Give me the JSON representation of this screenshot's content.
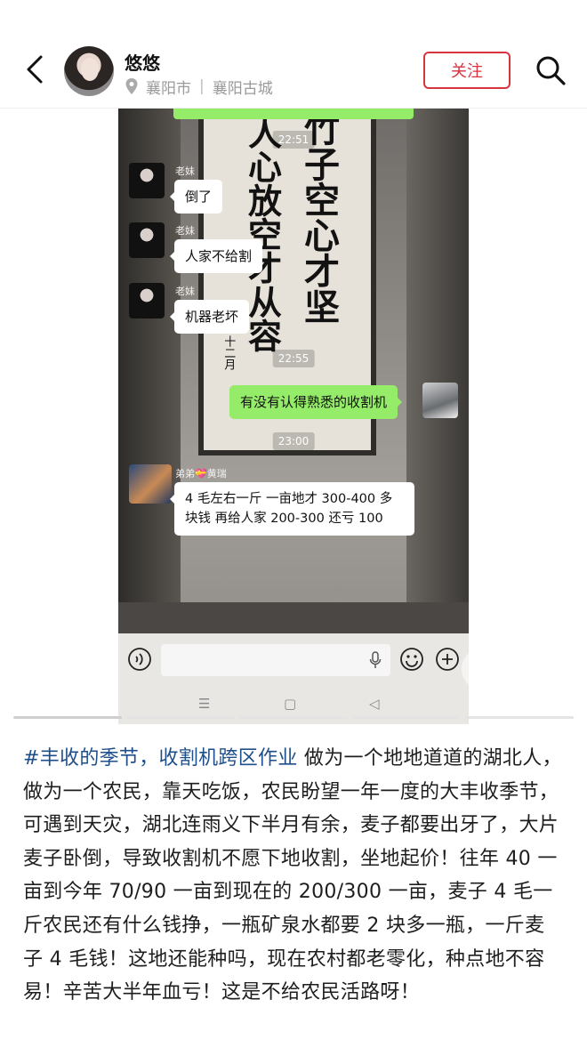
{
  "header": {
    "author": "悠悠",
    "location_city": "襄阳市",
    "location_separator": "|",
    "location_place": "襄阳古城",
    "follow_label": "关注"
  },
  "chat": {
    "messages": [
      {
        "type": "time",
        "text": "22:51"
      },
      {
        "type": "in",
        "sender": "老妹",
        "text": "倒了"
      },
      {
        "type": "in",
        "sender": "老妹",
        "text": "人家不给割"
      },
      {
        "type": "in",
        "sender": "老妹",
        "text": "机器老坏"
      },
      {
        "type": "time",
        "text": "22:55"
      },
      {
        "type": "out",
        "text": "有没有认得熟悉的收割机"
      },
      {
        "type": "time",
        "text": "23:00"
      },
      {
        "type": "in",
        "sender": "弟弟💝黄瑞",
        "line1": "4 毛左右一斤 一亩地才 300-400 多",
        "line2": "块钱 再给人家 200-300 还亏 100"
      }
    ]
  },
  "calligraphy": {
    "col1": "竹子空心才坚",
    "col2": "人心放空才从容",
    "col3": "十二月"
  },
  "phone_nav": {
    "menu": "☰",
    "home": "▢",
    "back": "◁"
  },
  "post": {
    "hashtag": "#丰收的季节，收割机跨区作业",
    "body": " 做为一个地地道道的湖北人，做为一个农民，靠天吃饭，农民盼望一年一度的大丰收季节，可遇到天灾，湖北连雨义下半月有余，麦子都要出牙了，大片麦子卧倒，导致收割机不愿下地收割，坐地起价！往年 40 一亩到今年 70/90 一亩到现在的 200/300 一亩，麦子 4 毛一斤农民还有什么钱挣，一瓶矿泉水都要 2 块多一瓶，一斤麦子 4 毛钱！这地还能种吗，现在农村都老零化，种点地不容易！辛苦大半年血亏！这是不给农民活路呀！"
  },
  "colors": {
    "accent": "#d8343d",
    "hashtag": "#1f4f8a",
    "wechat_green": "#95ec69"
  },
  "icons": [
    "back-chevron-icon",
    "location-pin-icon",
    "search-icon",
    "voice-icon",
    "microphone-icon",
    "emoji-icon",
    "plus-icon",
    "scan-icon",
    "play-icon"
  ]
}
